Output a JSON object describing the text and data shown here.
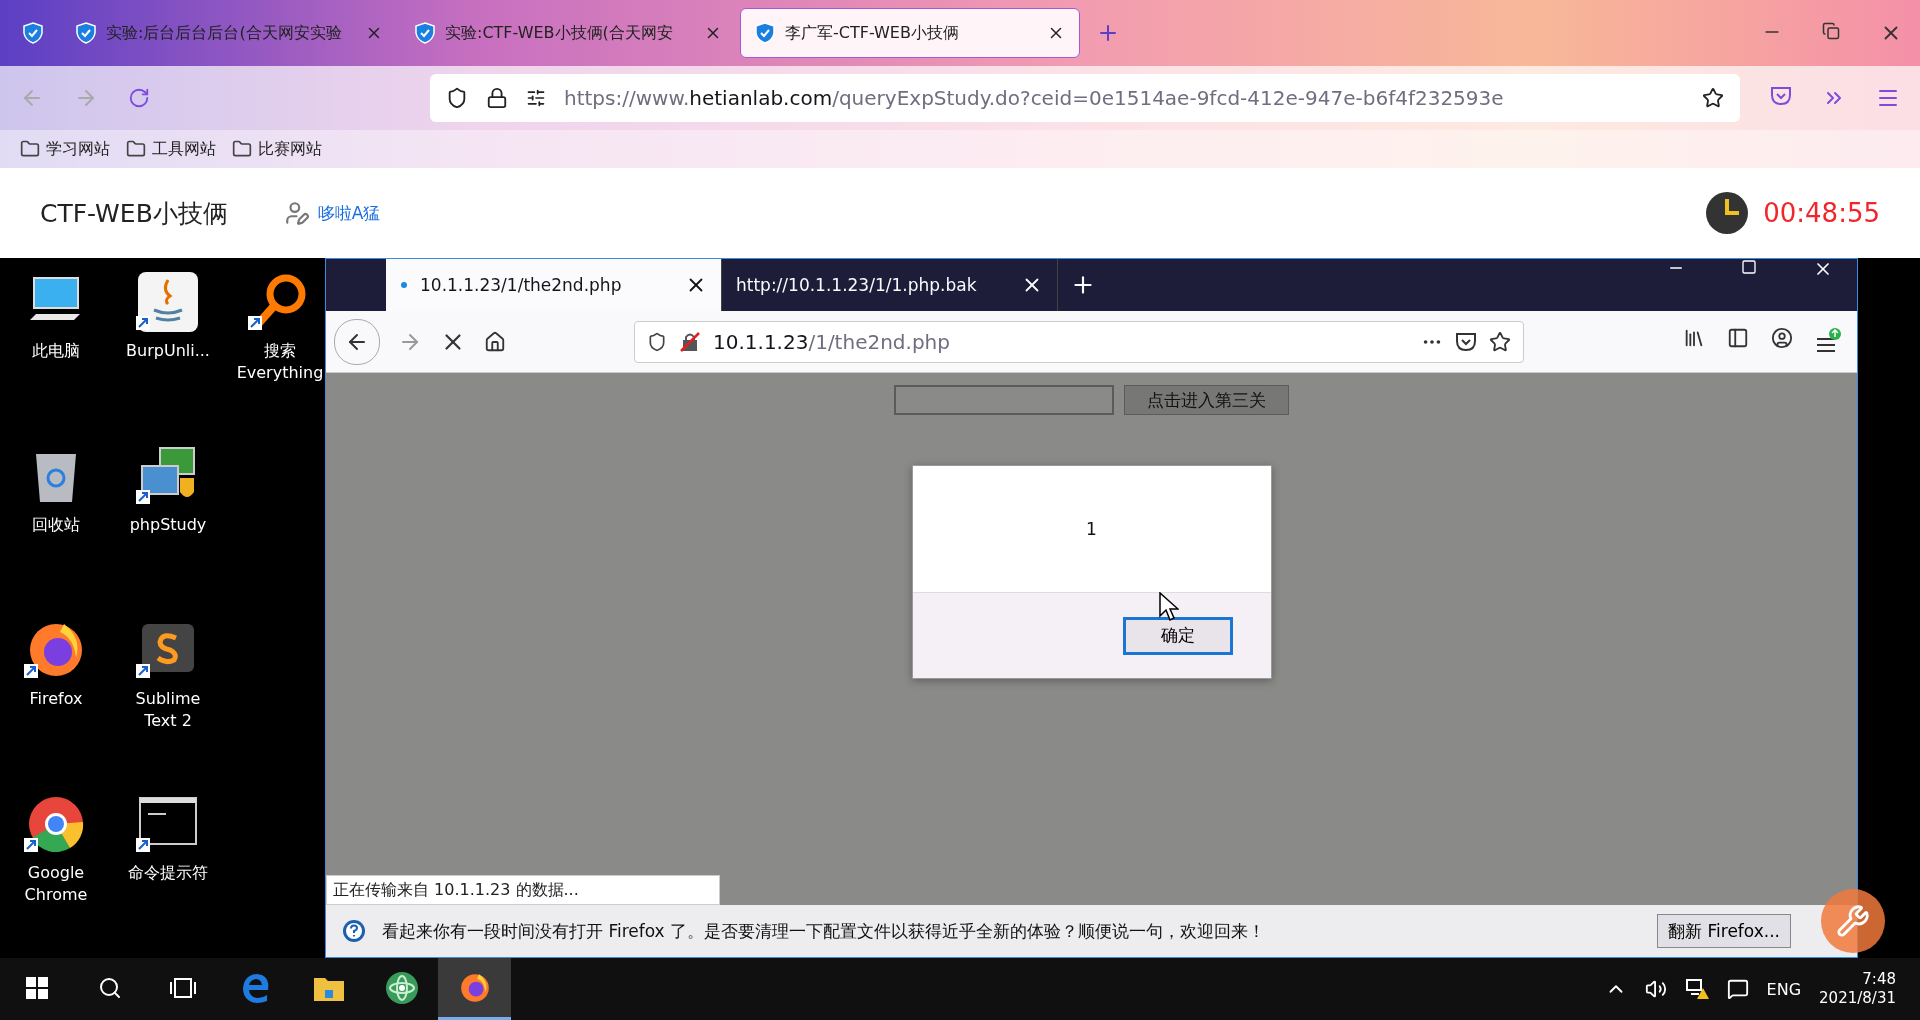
{
  "browser": {
    "tabs": [
      {
        "kind": "pinned",
        "selected": false
      },
      {
        "title": "实验:后台后台后台(合天网安实验",
        "selected": false
      },
      {
        "title": "实验:CTF-WEB小技俩(合天网安",
        "selected": false
      },
      {
        "title": "李广军-CTF-WEB小技俩",
        "selected": true
      }
    ],
    "url": [
      {
        "text": "https://www.",
        "highlighted": false
      },
      {
        "text": "hetianlab.com",
        "highlighted": true
      },
      {
        "text": "/queryExpStudy.do?ceid=0e1514ae-9fcd-412e-947e-b6f4f232593e",
        "highlighted": false
      }
    ],
    "bookmarks": [
      "学习网站",
      "工具网站",
      "比赛网站"
    ]
  },
  "page_header": {
    "title": "CTF-WEB小技俩",
    "user": "哆啦A猛",
    "timer": "00:48:55"
  },
  "desktop": {
    "icons": [
      {
        "kind": "computer",
        "label": "此电脑",
        "shortcut": false
      },
      {
        "kind": "recycle",
        "label": "回收站",
        "shortcut": false
      },
      {
        "kind": "firefox",
        "label": "Firefox",
        "shortcut": true
      },
      {
        "kind": "chrome",
        "label": "Google\nChrome",
        "shortcut": true
      },
      {
        "kind": "java",
        "label": "BurpUnli...",
        "shortcut": true
      },
      {
        "kind": "phpstudy",
        "label": "phpStudy",
        "shortcut": true
      },
      {
        "kind": "sublime",
        "label": "Sublime\nText 2",
        "shortcut": true
      },
      {
        "kind": "cmd",
        "label": "命令提示符",
        "shortcut": true
      },
      {
        "kind": "search",
        "label": "搜索\nEverything",
        "shortcut": true
      }
    ]
  },
  "inner_browser": {
    "tabs": [
      {
        "title": "10.1.1.23/1/the2nd.php",
        "selected": true,
        "loading": true
      },
      {
        "title": "http://10.1.1.23/1/1.php.bak",
        "selected": false,
        "loading": false
      }
    ],
    "url": [
      {
        "text": "10.1.1.23",
        "highlighted": true
      },
      {
        "text": "/1/the2nd.php",
        "highlighted": false
      }
    ],
    "form": {
      "button": "点击进入第三关"
    },
    "alert": {
      "message": "1",
      "button": "确定"
    },
    "status": "正在传输来自 10.1.1.23 的数据...",
    "notification": {
      "text": "看起来你有一段时间没有打开 Firefox 了。是否要清理一下配置文件以获得近乎全新的体验？顺便说一句，欢迎回来！",
      "button": "翻新 Firefox..."
    }
  },
  "taskbar": {
    "apps": [
      {
        "kind": "start",
        "selected": false
      },
      {
        "kind": "search",
        "selected": false
      },
      {
        "kind": "taskview",
        "selected": false
      },
      {
        "kind": "edge",
        "selected": false
      },
      {
        "kind": "explorer",
        "selected": false
      },
      {
        "kind": "atom",
        "selected": false
      },
      {
        "kind": "firefox",
        "selected": true
      }
    ],
    "language": "ENG",
    "time": "7:48",
    "date": "2021/8/31"
  }
}
